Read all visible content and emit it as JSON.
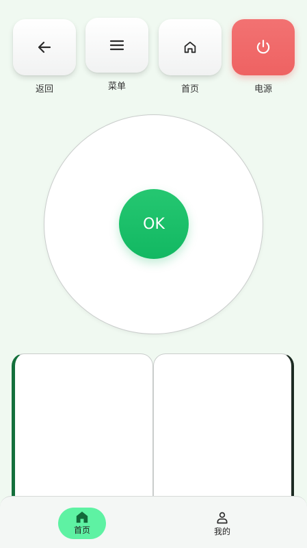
{
  "controls": {
    "back_label": "返回",
    "menu_label": "菜单",
    "home_label": "首页",
    "power_label": "电源"
  },
  "dpad": {
    "ok_label": "OK"
  },
  "bottom_nav": {
    "home_label": "首页",
    "mine_label": "我的"
  },
  "colors": {
    "background": "#f0f9f1",
    "accent_green": "#12b862",
    "power_red": "#ee6262",
    "nav_active": "#5ef2a3"
  }
}
